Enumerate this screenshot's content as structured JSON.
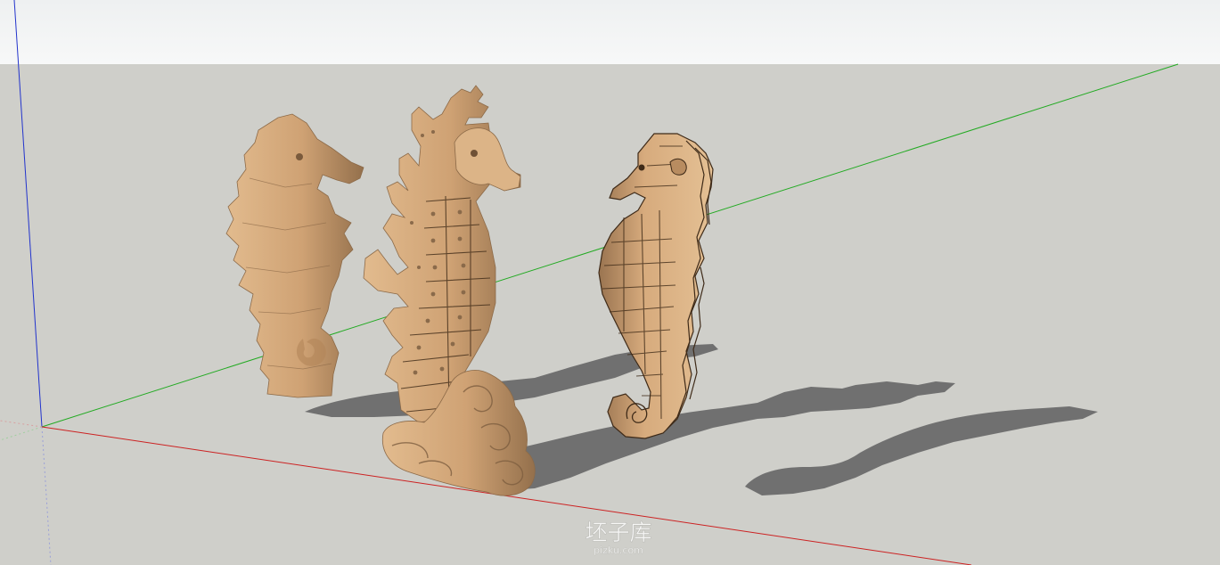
{
  "scene": {
    "colors": {
      "sky_top": "#eef0f1",
      "sky_bottom": "#f7f8f8",
      "ground": "#cfcfca",
      "model_light": "#e2bb8e",
      "model_mid": "#cfa274",
      "model_dark": "#94704c",
      "shadow": "#707070",
      "axis_red": "#cc2222",
      "axis_green": "#22aa22",
      "axis_blue": "#2233cc"
    },
    "models": [
      {
        "name": "seahorse-faceted"
      },
      {
        "name": "seahorse-ornamental-on-waves"
      },
      {
        "name": "seahorse-sliced-contour"
      }
    ]
  },
  "watermark": {
    "cn": "坯子库",
    "en": "pizku.com"
  }
}
